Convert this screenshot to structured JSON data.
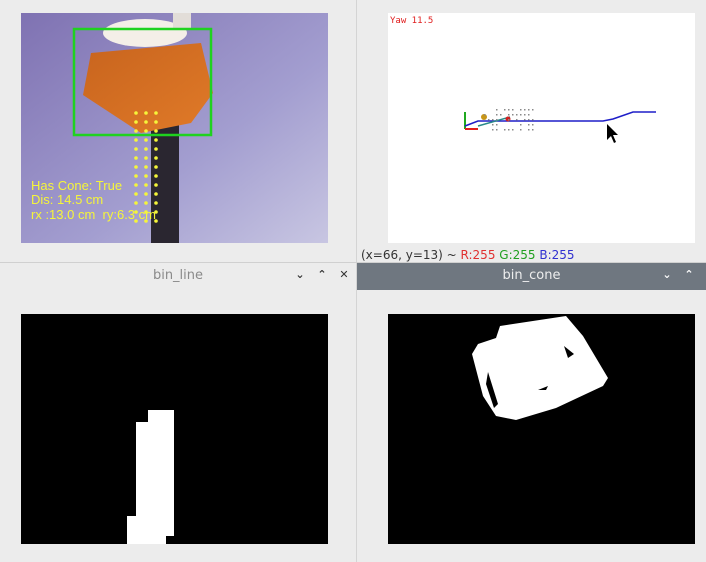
{
  "windows": {
    "camera": {
      "overlay_lines": [
        "Has Cone: True",
        "Dis: 14.5 cm",
        "rx :13.0 cm  ry:6.3 cm"
      ]
    },
    "plot": {
      "yaw_label": "Yaw 11.5",
      "status": {
        "coords": "(x=66, y=13) ~ ",
        "r": "R:255",
        "g": "G:255",
        "b": "B:255"
      }
    },
    "bin_line": {
      "title": "bin_line",
      "btn_min": "⌄",
      "btn_max": "⌃",
      "btn_close": "✕"
    },
    "bin_cone": {
      "title": "bin_cone",
      "btn_min": "⌄",
      "btn_max": "⌃"
    }
  },
  "colors": {
    "overlay_text": "#f5f53a",
    "box": "#1fd21f",
    "path": "#1e1ec8",
    "active_titlebar": "#6f7780",
    "status_r": "#e03030",
    "status_g": "#20a020",
    "status_b": "#3030d0"
  }
}
